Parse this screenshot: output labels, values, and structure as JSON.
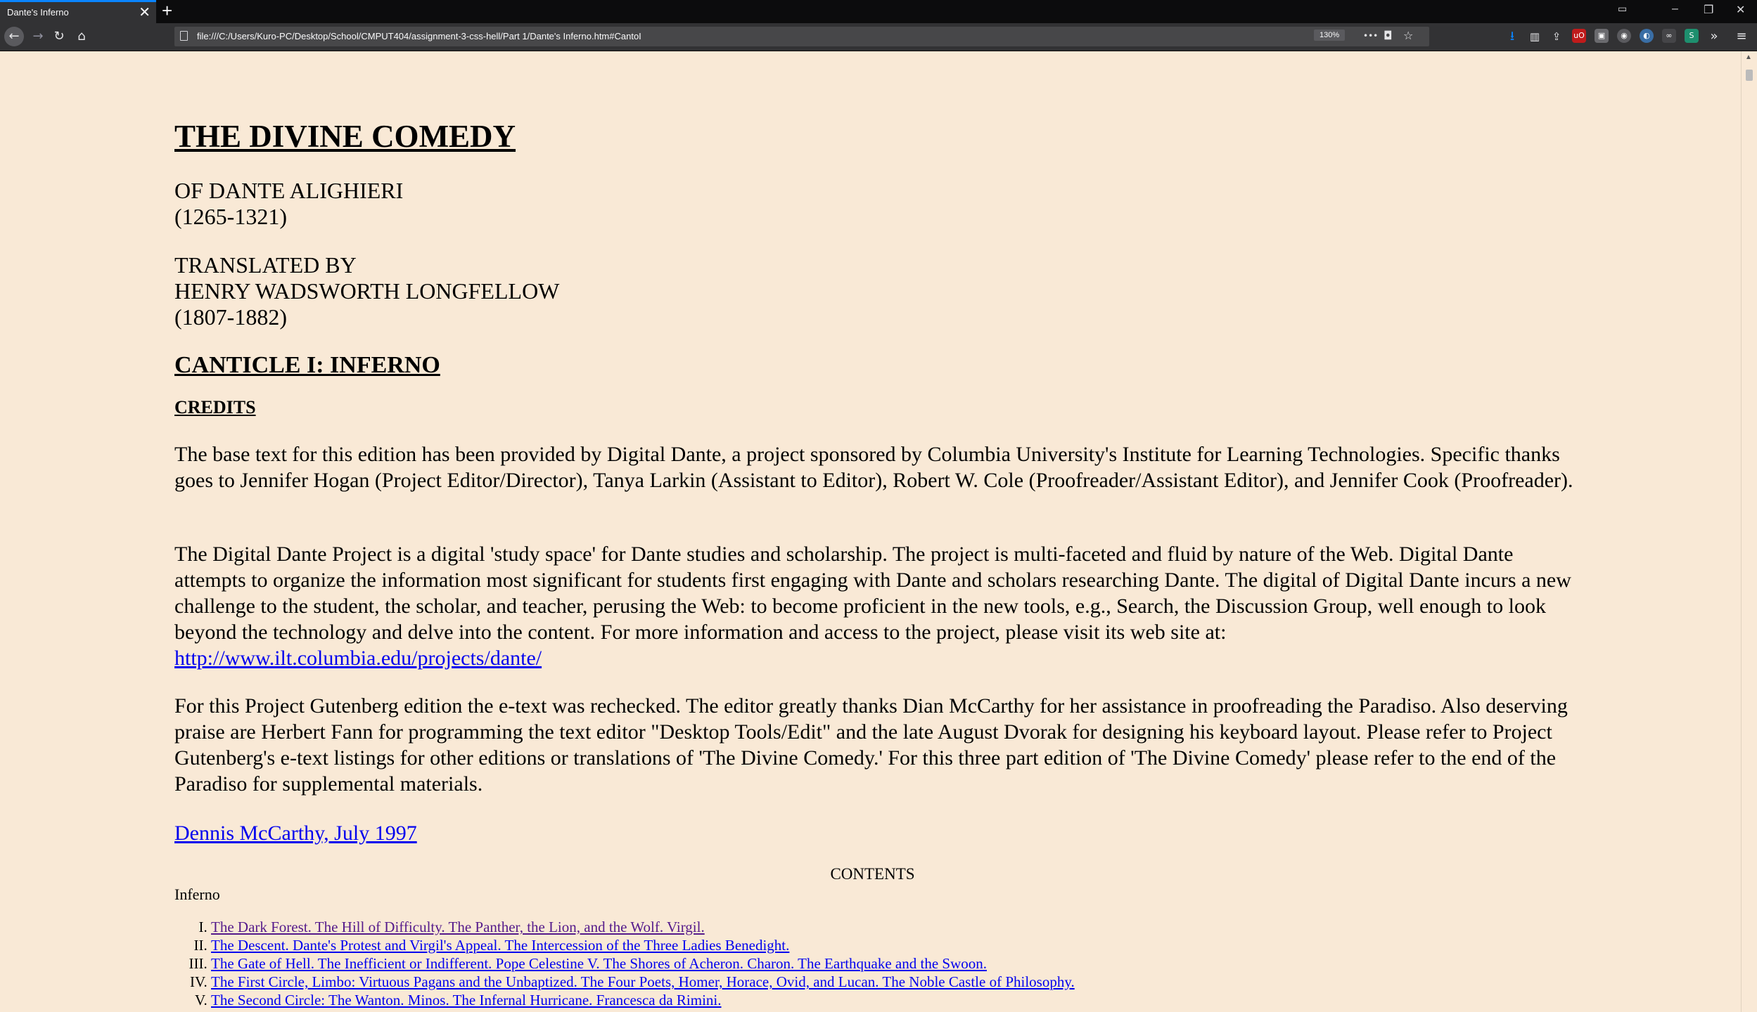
{
  "browser": {
    "tab_title": "Dante's Inferno",
    "tab_close": "✕",
    "new_tab": "+",
    "url": "file:///C:/Users/Kuro-PC/Desktop/School/CMPUT404/assignment-3-css-hell/Part 1/Dante's Inferno.htm#CantoI",
    "zoom": "130%",
    "menu_dots": "•••"
  },
  "page": {
    "title": "THE DIVINE COMEDY",
    "author_line1": "OF DANTE ALIGHIERI",
    "author_line2": "(1265-1321)",
    "translator_line1": "TRANSLATED BY",
    "translator_line2": "HENRY WADSWORTH LONGFELLOW",
    "translator_line3": "(1807-1882)",
    "canticle": "CANTICLE I: INFERNO",
    "credits_heading": "CREDITS",
    "para1": "The base text for this edition has been provided by Digital Dante, a project sponsored by Columbia University's Institute for Learning Technologies. Specific thanks goes to Jennifer Hogan (Project Editor/Director), Tanya Larkin (Assistant to Editor), Robert W. Cole (Proofreader/Assistant Editor), and Jennifer Cook (Proofreader).",
    "para2": "The Digital Dante Project is a digital 'study space' for Dante studies and scholarship. The project is multi-faceted and fluid by nature of the Web. Digital Dante attempts to organize the information most significant for students first engaging with Dante and scholars researching Dante. The digital of Digital Dante incurs a new challenge to the student, the scholar, and teacher, perusing the Web: to become proficient in the new tools, e.g., Search, the Discussion Group, well enough to look beyond the technology and delve into the content. For more information and access to the project, please visit its web site at:",
    "para2_link": "http://www.ilt.columbia.edu/projects/dante/",
    "para3": "For this Project Gutenberg edition the e-text was rechecked. The editor greatly thanks Dian McCarthy for her assistance in proofreading the Paradiso. Also deserving praise are Herbert Fann for programming the text editor \"Desktop Tools/Edit\" and the late August Dvorak for designing his keyboard layout. Please refer to Project Gutenberg's e-text listings for other editions or translations of 'The Divine Comedy.' For this three part edition of 'The Divine Comedy' please refer to the end of the Paradiso for supplemental materials.",
    "signature_link": "Dennis McCarthy, July 1997",
    "contents_heading": "CONTENTS",
    "inferno_label": "Inferno",
    "cantos": [
      "The Dark Forest. The Hill of Difficulty. The Panther, the Lion, and the Wolf. Virgil.",
      "The Descent. Dante's Protest and Virgil's Appeal. The Intercession of the Three Ladies Benedight.",
      "The Gate of Hell. The Inefficient or Indifferent. Pope Celestine V. The Shores of Acheron. Charon. The Earthquake and the Swoon.",
      "The First Circle, Limbo: Virtuous Pagans and the Unbaptized. The Four Poets, Homer, Horace, Ovid, and Lucan. The Noble Castle of Philosophy.",
      "The Second Circle: The Wanton. Minos. The Infernal Hurricane. Francesca da Rimini."
    ]
  },
  "colors": {
    "page_bg": "#f9e9d6",
    "link": "#0000ee",
    "visited_link": "#551a8b",
    "chrome_dark": "#0c0c0d",
    "chrome_toolbar": "#323234",
    "tab_accent": "#0a84ff"
  }
}
